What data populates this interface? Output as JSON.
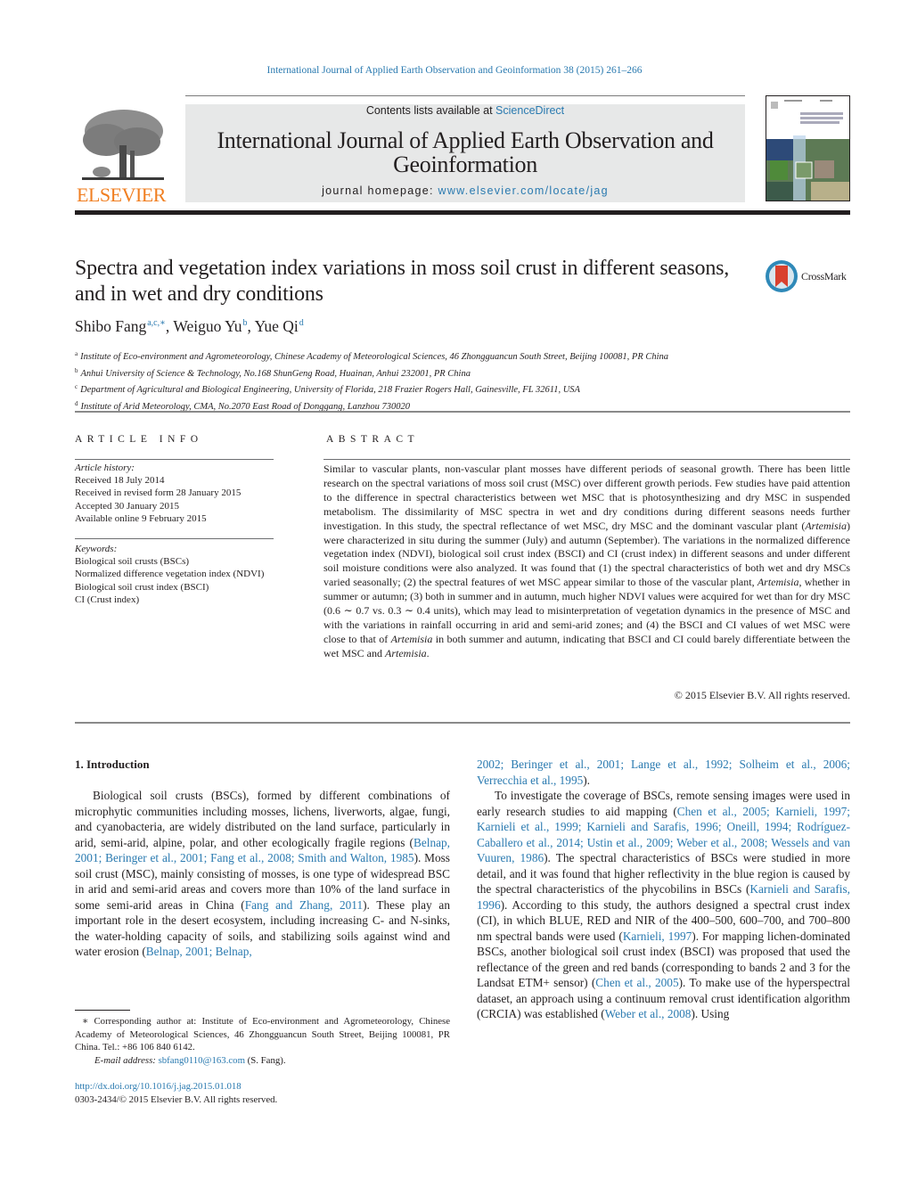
{
  "header": {
    "journal_ref": "International Journal of Applied Earth Observation and Geoinformation 38 (2015) 261–266",
    "contents_prefix": "Contents lists available at ",
    "contents_link": "ScienceDirect",
    "journal_title": "International Journal of Applied Earth Observation and Geoinformation",
    "homepage_prefix": "journal homepage: ",
    "homepage_link": "www.elsevier.com/locate/jag",
    "publisher_logo": "ELSEVIER",
    "crossmark_label": "CrossMark"
  },
  "article": {
    "title": "Spectra and vegetation index variations in moss soil crust in different seasons, and in wet and dry conditions",
    "authors": [
      {
        "name": "Shibo Fang",
        "marks": "a,c,∗"
      },
      {
        "name": "Weiguo Yu",
        "marks": "b"
      },
      {
        "name": "Yue Qi",
        "marks": "d"
      }
    ],
    "affiliations": [
      {
        "mark": "a",
        "text": "Institute of Eco-environment and Agrometeorology, Chinese Academy of Meteorological Sciences, 46 Zhongguancun South Street, Beijing 100081, PR China"
      },
      {
        "mark": "b",
        "text": "Anhui University of Science & Technology, No.168 ShunGeng Road, Huainan, Anhui 232001, PR China"
      },
      {
        "mark": "c",
        "text": "Department of Agricultural and Biological Engineering, University of Florida, 218 Frazier Rogers Hall, Gainesville, FL 32611, USA"
      },
      {
        "mark": "d",
        "text": "Institute of Arid Meteorology, CMA, No.2070 East Road of Donggang, Lanzhou 730020"
      }
    ]
  },
  "article_info": {
    "heading": "ARTICLE INFO",
    "history_label": "Article history:",
    "history": [
      "Received 18 July 2014",
      "Received in revised form 28 January 2015",
      "Accepted 30 January 2015",
      "Available online 9 February 2015"
    ],
    "keywords_label": "Keywords:",
    "keywords": [
      "Biological soil crusts (BSCs)",
      "Normalized difference vegetation index (NDVI)",
      "Biological soil crust index (BSCI)",
      "CI (Crust index)"
    ]
  },
  "abstract": {
    "heading": "ABSTRACT",
    "segments": [
      {
        "t": "Similar to vascular plants, non-vascular plant mosses have different periods of seasonal growth. There has been little research on the spectral variations of moss soil crust (MSC) over different growth periods. Few studies have paid attention to the difference in spectral characteristics between wet MSC that is photosynthesizing and dry MSC in suspended metabolism. The dissimilarity of MSC spectra in wet and dry conditions during different seasons needs further investigation. In this study, the spectral reflectance of wet MSC, dry MSC and the dominant vascular plant ("
      },
      {
        "t": "Artemisia",
        "i": true
      },
      {
        "t": ") were characterized in situ during the summer (July) and autumn (September). The variations in the normalized difference vegetation index (NDVI), biological soil crust index (BSCI) and CI (crust index) in different seasons and under different soil moisture conditions were also analyzed. It was found that (1) the spectral characteristics of both wet and dry MSCs varied seasonally; (2) the spectral features of wet MSC appear similar to those of the vascular plant, "
      },
      {
        "t": "Artemisia",
        "i": true
      },
      {
        "t": ", whether in summer or autumn; (3) both in summer and in autumn, much higher NDVI values were acquired for wet than for dry MSC (0.6 ∼ 0.7 vs. 0.3 ∼ 0.4 units), which may lead to misinterpretation of vegetation dynamics in the presence of MSC and with the variations in rainfall occurring in arid and semi-arid zones; and (4) the BSCI and CI values of wet MSC were close to that of "
      },
      {
        "t": "Artemisia",
        "i": true
      },
      {
        "t": " in both summer and autumn, indicating that BSCI and CI could barely differentiate between the wet MSC and "
      },
      {
        "t": "Artemisia",
        "i": true
      },
      {
        "t": "."
      }
    ],
    "copyright": "© 2015 Elsevier B.V. All rights reserved."
  },
  "introduction": {
    "heading": "1.  Introduction",
    "left_paragraphs": [
      [
        {
          "t": "Biological soil crusts (BSCs), formed by different combinations of microphytic communities including mosses, lichens, liverworts, algae, fungi, and cyanobacteria, are widely distributed on the land surface, particularly in arid, semi-arid, alpine, polar, and other ecologically fragile regions ("
        },
        {
          "t": "Belnap, 2001; Beringer et al., 2001; Fang et al., 2008; Smith and Walton, 1985",
          "l": true
        },
        {
          "t": "). Moss soil crust (MSC), mainly consisting of mosses, is one type of widespread BSC in arid and semi-arid areas and covers more than 10% of the land surface in some semi-arid areas in China ("
        },
        {
          "t": "Fang and Zhang, 2011",
          "l": true
        },
        {
          "t": "). These play an important role in the desert ecosystem, including increasing C- and N-sinks, the water-holding capacity of soils, and stabilizing soils against wind and water erosion ("
        },
        {
          "t": "Belnap, 2001; Belnap,",
          "l": true
        }
      ]
    ],
    "right_paragraphs": [
      [
        {
          "t": "2002; Beringer et al., 2001; Lange et al., 1992; Solheim et al., 2006; Verrecchia et al., 1995",
          "l": true
        },
        {
          "t": ")."
        }
      ],
      [
        {
          "t": "To investigate the coverage of BSCs, remote sensing images were used in early research studies to aid mapping ("
        },
        {
          "t": "Chen et al., 2005; Karnieli, 1997; Karnieli et al., 1999; Karnieli and Sarafis, 1996; Oneill, 1994; Rodríguez-Caballero et al., 2014; Ustin et al., 2009; Weber et al., 2008; Wessels and van Vuuren, 1986",
          "l": true
        },
        {
          "t": "). The spectral characteristics of BSCs were studied in more detail, and it was found that higher reflectivity in the blue region is caused by the spectral characteristics of the phycobilins in BSCs ("
        },
        {
          "t": "Karnieli and Sarafis, 1996",
          "l": true
        },
        {
          "t": "). According to this study, the authors designed a spectral crust index (CI), in which BLUE, RED and NIR of the 400–500, 600–700, and 700–800 nm spectral bands were used ("
        },
        {
          "t": "Karnieli, 1997",
          "l": true
        },
        {
          "t": "). For mapping lichen-dominated BSCs, another biological soil crust index (BSCI) was proposed that used the reflectance of the green and red bands (corresponding to bands 2 and 3 for the Landsat ETM+ sensor) ("
        },
        {
          "t": "Chen et al., 2005",
          "l": true
        },
        {
          "t": "). To make use of the hyperspectral dataset, an approach using a continuum removal crust identification algorithm (CRCIA) was established ("
        },
        {
          "t": "Weber et al., 2008",
          "l": true
        },
        {
          "t": "). Using"
        }
      ]
    ]
  },
  "footnote": {
    "corresponding": "∗  Corresponding author at: Institute of Eco-environment and Agrometeorology, Chinese Academy of Meteorological Sciences, 46 Zhongguancun South Street, Beijing 100081, PR China. Tel.: +86 106 840 6142.",
    "email_label": "E-mail address: ",
    "email": "sbfang0110@163.com",
    "email_suffix": " (S. Fang).",
    "doi": "http://dx.doi.org/10.1016/j.jag.2015.01.018",
    "issn": "0303-2434/© 2015 Elsevier B.V. All rights reserved."
  },
  "colors": {
    "link": "#2a7ab0",
    "elsevier_orange": "#f07f22",
    "banner_grey": "#e7e8e8",
    "text": "#231f20"
  }
}
